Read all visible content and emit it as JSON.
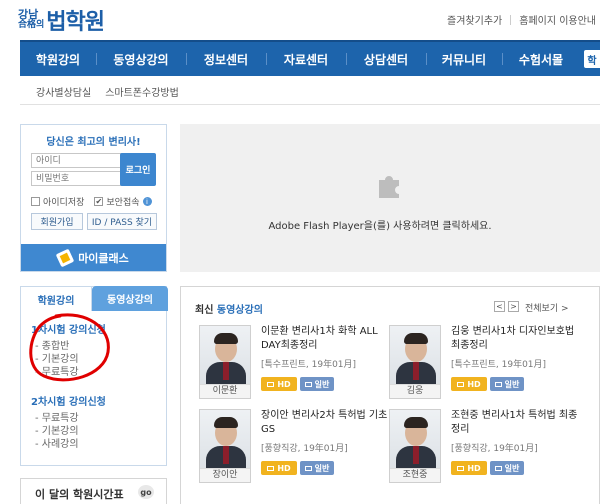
{
  "header": {
    "logo_small_top": "강남",
    "logo_small_bottom": "合格의",
    "logo_big": "법학원",
    "top_links": [
      "즐겨찾기추가",
      "홈페이지 이용안내"
    ]
  },
  "gnb": {
    "items": [
      "학원강의",
      "동영상강의",
      "정보센터",
      "자료센터",
      "상담센터",
      "커뮤니티",
      "수험서몰"
    ],
    "lang": "학"
  },
  "subnav": {
    "items": [
      "강사별상담실",
      "스마트폰수강방법"
    ]
  },
  "login": {
    "title": "당신은 최고의 변리사!",
    "id_placeholder": "아이디",
    "pw_placeholder": "비밀번호",
    "login_button": "로그인",
    "save_id": "아이디저장",
    "secure_login": "보안접속",
    "info_icon": "i",
    "join": "회원가입",
    "find": "ID / PASS 찾기",
    "myclass": "마이클래스"
  },
  "flash": {
    "message": "Adobe Flash Player을(를) 사용하려면 클릭하세요.",
    "icon": "puzzle-icon"
  },
  "course_tabs": {
    "tab1": "학원강의",
    "tab2": "동영상강의",
    "group1_title": "1차시험 강의신청",
    "group1_items": [
      "- 종합반",
      "- 기본강의",
      "- 무료특강"
    ],
    "group2_title": "2차시험 강의신청",
    "group2_items": [
      "- 무료특강",
      "- 기본강의",
      "- 사례강의"
    ]
  },
  "monthly": {
    "label": "이 달의 학원시간표",
    "go": "go"
  },
  "latest": {
    "title_prefix": "최신",
    "title_accent": "동영상강의",
    "prev": "<",
    "next": ">",
    "see_all": "전체보기 >",
    "hd_label": "HD",
    "normal_label": "일반",
    "cards": [
      {
        "name": "이문환",
        "title": "이문환 변리사1차 화학 ALL DAY최종정리",
        "meta": "[특수프린트, 19年01月]"
      },
      {
        "name": "김웅",
        "title": "김웅 변리사1차 디자인보호법 최종정리",
        "meta": "[특수프린트, 19年01月]"
      },
      {
        "name": "장이안",
        "title": "장이안 변리사2차 특허법 기초GS",
        "meta": "[풍향직강, 19年01月]"
      },
      {
        "name": "조현중",
        "title": "조현중 변리사1차 특허법 최종정리",
        "meta": "[풍향직강, 19年01月]"
      }
    ]
  },
  "colors": {
    "brand_blue": "#1d64ac",
    "accent_blue": "#2a6fb8",
    "hd_yellow": "#f1b31f",
    "annotation_red": "#e00000"
  }
}
